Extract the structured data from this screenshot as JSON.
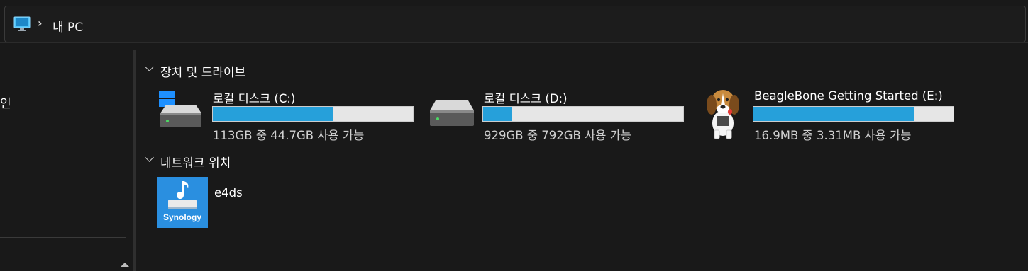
{
  "address_bar": {
    "icon": "monitor-icon",
    "separator": "›",
    "location": "내 PC"
  },
  "sidebar": {
    "partial_label": "인"
  },
  "sections": {
    "devices": {
      "title": "장치 및 드라이브",
      "drives": [
        {
          "name": "로컬 디스크 (C:)",
          "size_text": "113GB 중 44.7GB 사용 가능",
          "used_fraction": 0.604,
          "icon": "windows-drive-icon"
        },
        {
          "name": "로컬 디스크 (D:)",
          "size_text": "929GB 중 792GB 사용 가능",
          "used_fraction": 0.147,
          "icon": "hard-drive-icon"
        },
        {
          "name": "BeagleBone Getting Started (E:)",
          "size_text": "16.9MB 중 3.31MB 사용 가능",
          "used_fraction": 0.804,
          "icon": "beagle-dog-icon"
        }
      ]
    },
    "network": {
      "title": "네트워크 위치",
      "items": [
        {
          "name": "e4ds",
          "icon": "synology-nas-icon",
          "badge": "Synology"
        }
      ]
    }
  },
  "colors": {
    "background": "#191919",
    "bar_fill": "#26a0da",
    "bar_empty": "#e6e6e6"
  }
}
